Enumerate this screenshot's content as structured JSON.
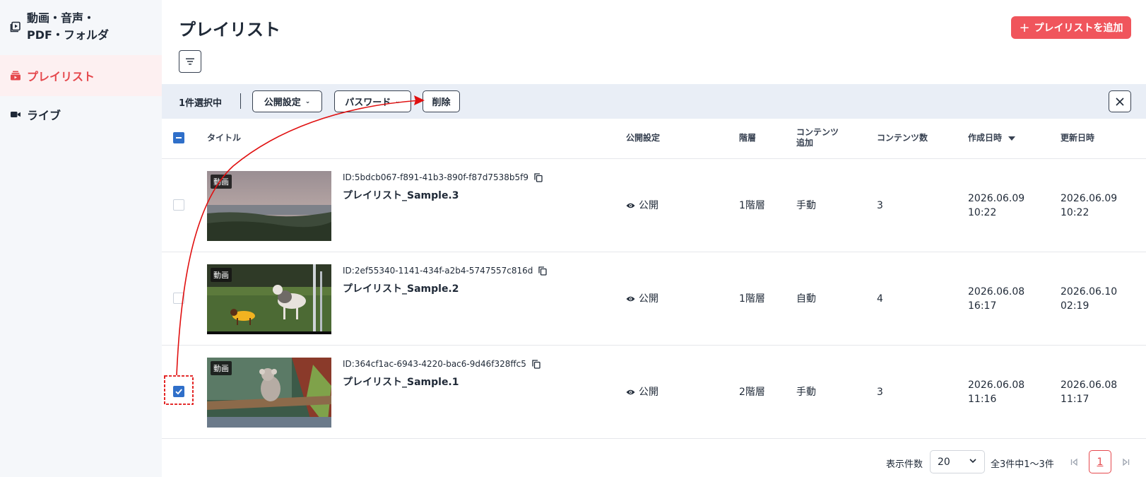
{
  "sidebar": {
    "items": [
      {
        "label_line1": "動画・音声・",
        "label_line2": "PDF・フォルダ"
      },
      {
        "label": "プレイリスト"
      },
      {
        "label": "ライブ"
      }
    ]
  },
  "header": {
    "title": "プレイリスト",
    "add_button": "プレイリストを追加"
  },
  "bulk": {
    "count": "1件選択中",
    "visibility": "公開設定",
    "password": "パスワード",
    "delete": "削除"
  },
  "table": {
    "headers": {
      "title": "タイトル",
      "visibility": "公開設定",
      "level": "階層",
      "content_add_1": "コンテンツ",
      "content_add_2": "追加",
      "content_count": "コンテンツ数",
      "created": "作成日時",
      "updated": "更新日時"
    },
    "rows": [
      {
        "tag": "動画",
        "id": "ID:5bdcb067-f891-41b3-890f-f87d7538b5f9",
        "title": "プレイリスト_Sample.3",
        "visibility": "公開",
        "level": "1階層",
        "add_mode": "手動",
        "count": "3",
        "created_date": "2026.06.09",
        "created_time": "10:22",
        "updated_date": "2026.06.09",
        "updated_time": "10:22",
        "checked": false
      },
      {
        "tag": "動画",
        "id": "ID:2ef55340-1141-434f-a2b4-5747557c816d",
        "title": "プレイリスト_Sample.2",
        "visibility": "公開",
        "level": "1階層",
        "add_mode": "自動",
        "count": "4",
        "created_date": "2026.06.08",
        "created_time": "16:17",
        "updated_date": "2026.06.10",
        "updated_time": "02:19",
        "checked": false
      },
      {
        "tag": "動画",
        "id": "ID:364cf1ac-6943-4220-bac6-9d46f328ffc5",
        "title": "プレイリスト_Sample.1",
        "visibility": "公開",
        "level": "2階層",
        "add_mode": "手動",
        "count": "3",
        "created_date": "2026.06.08",
        "created_time": "11:16",
        "updated_date": "2026.06.08",
        "updated_time": "11:17",
        "checked": true
      }
    ]
  },
  "pagination": {
    "per_page_label": "表示件数",
    "per_page": "20",
    "range": "全3件中1〜3件",
    "current_page": "1"
  },
  "colors": {
    "accent": "#e5484d",
    "add_button": "#f0555c",
    "checkbox": "#2f6fc9",
    "bulk_bar": "#e9eef6",
    "annotation": "#e01010"
  }
}
